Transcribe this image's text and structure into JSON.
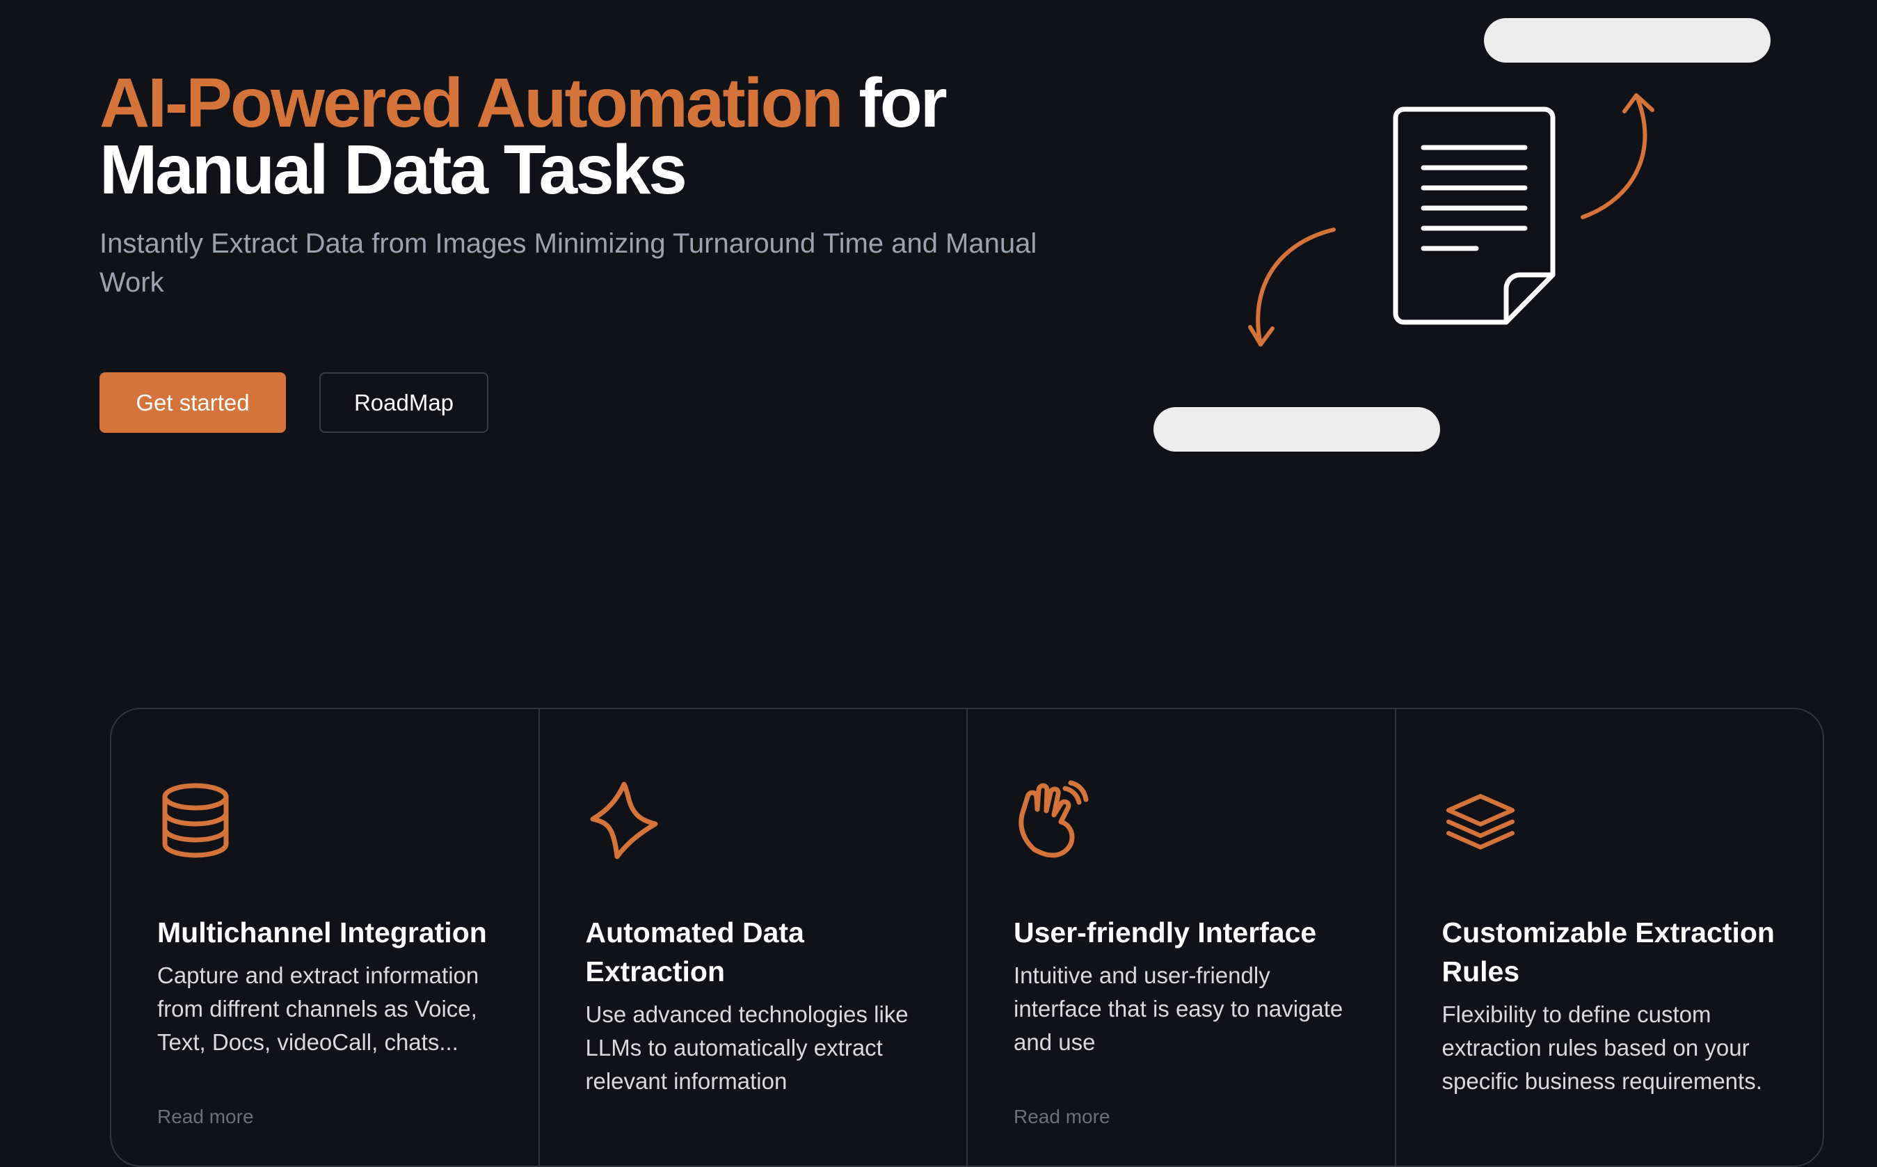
{
  "hero": {
    "title_accent": "AI-Powered Automation",
    "title_rest_line1": " for",
    "title_line2": "Manual Data Tasks",
    "subtitle": "Instantly Extract Data from Images Minimizing Turnaround Time and Manual Work",
    "primary_button": "Get started",
    "secondary_button": "RoadMap"
  },
  "colors": {
    "accent": "#d4733a",
    "background": "#111217"
  },
  "features": [
    {
      "icon": "database-icon",
      "title": "Multichannel Integration",
      "description": "Capture and extract information from diffrent channels as Voice, Text, Docs, videoCall, chats...",
      "link": "Read more"
    },
    {
      "icon": "lightning-icon",
      "title": "Automated Data Extraction",
      "description": "Use advanced technologies like LLMs to automatically extract relevant information",
      "link": ""
    },
    {
      "icon": "waving-hand-icon",
      "title": "User-friendly Interface",
      "description": "Intuitive and user-friendly interface that is easy to navigate and use",
      "link": "Read more"
    },
    {
      "icon": "stack-layers-icon",
      "title": "Customizable Extraction Rules",
      "description": "Flexibility to define custom extraction rules based on your specific business requirements.",
      "link": ""
    }
  ]
}
